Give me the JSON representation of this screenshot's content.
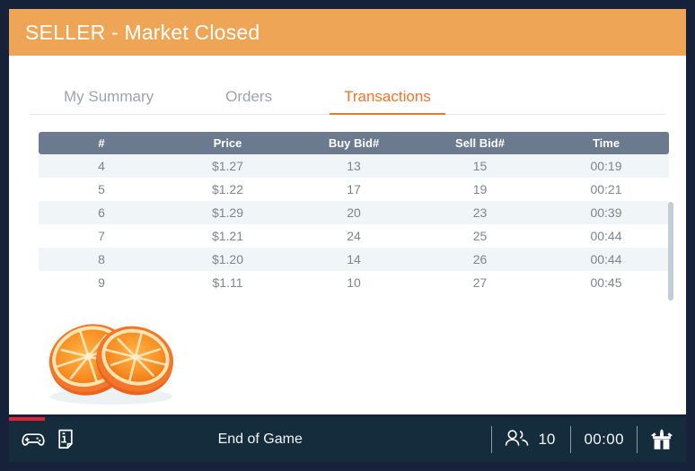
{
  "theme": {
    "page_background": "#15223A",
    "header_orange": "#EFA556",
    "accent_orange": "#F2742A",
    "table_header_slate": "#6B7A8F",
    "row_stripe": "#F0F5F7",
    "footer_background": "#152C3D",
    "footer_accent_red": "#E0213C"
  },
  "header": {
    "title": "SELLER - Market Closed"
  },
  "tabs": [
    {
      "label": "My Summary",
      "name": "tab-my-summary",
      "active": false
    },
    {
      "label": "Orders",
      "name": "tab-orders",
      "active": false
    },
    {
      "label": "Transactions",
      "name": "tab-transactions",
      "active": true
    }
  ],
  "table": {
    "columns": [
      "#",
      "Price",
      "Buy Bid#",
      "Sell Bid#",
      "Time"
    ],
    "rows": [
      {
        "num": "4",
        "price": "$1.27",
        "buy_bid": "13",
        "sell_bid": "15",
        "time": "00:19"
      },
      {
        "num": "5",
        "price": "$1.22",
        "buy_bid": "17",
        "sell_bid": "19",
        "time": "00:21"
      },
      {
        "num": "6",
        "price": "$1.29",
        "buy_bid": "20",
        "sell_bid": "23",
        "time": "00:39"
      },
      {
        "num": "7",
        "price": "$1.21",
        "buy_bid": "24",
        "sell_bid": "25",
        "time": "00:44"
      },
      {
        "num": "8",
        "price": "$1.20",
        "buy_bid": "14",
        "sell_bid": "26",
        "time": "00:44"
      },
      {
        "num": "9",
        "price": "$1.11",
        "buy_bid": "10",
        "sell_bid": "27",
        "time": "00:45"
      }
    ]
  },
  "commodity": {
    "icon": "orange-fruit-image",
    "alt": "oranges"
  },
  "footer": {
    "icons": [
      {
        "name": "gamepad-icon"
      },
      {
        "name": "info-document-icon"
      }
    ],
    "status_text": "End of Game",
    "players_icon": "people-icon",
    "players_count": "10",
    "clock": "00:00",
    "logo_icon": "mobilab-logo-icon"
  }
}
